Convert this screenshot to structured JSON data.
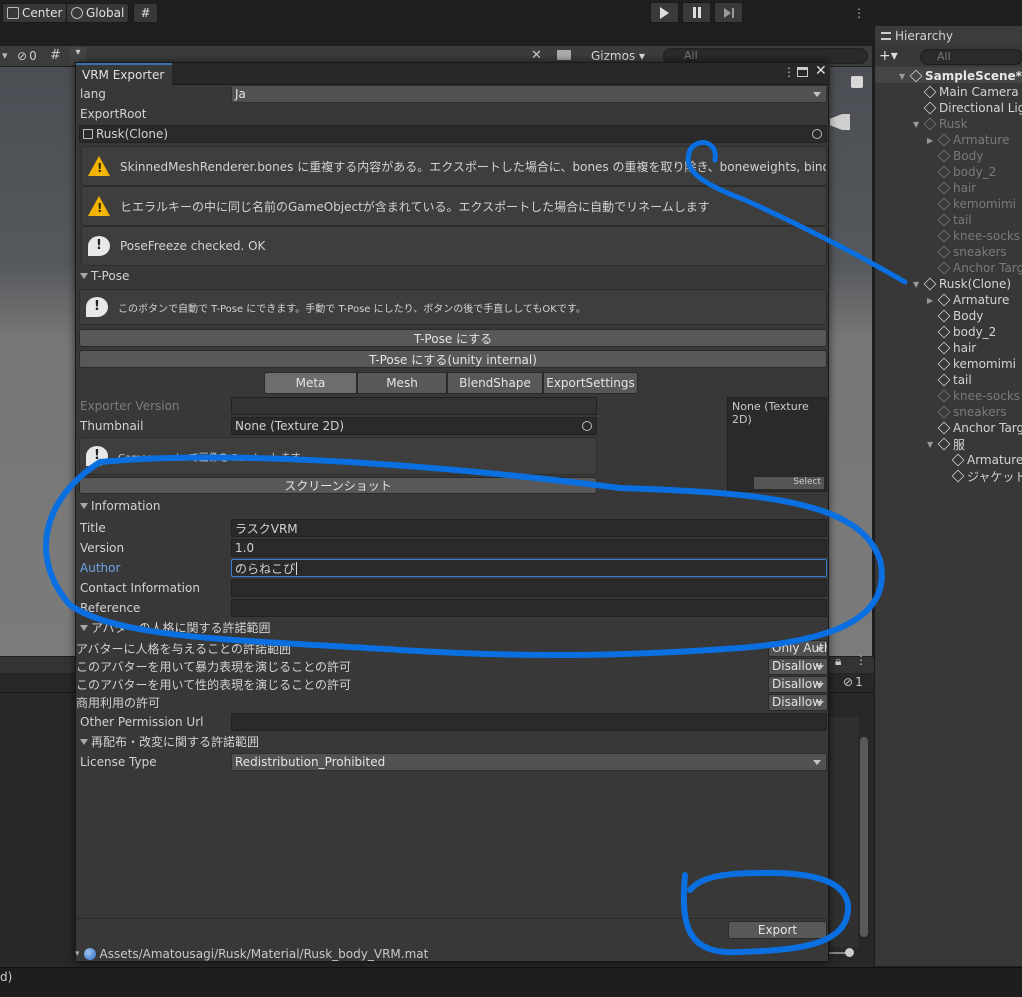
{
  "toolbar": {
    "center": "Center",
    "global": "Global"
  },
  "scene": {
    "gizmos": "Gizmos",
    "search_placeholder": "All",
    "vis_count": "0"
  },
  "hierarchy": {
    "title": "Hierarchy",
    "search_placeholder": "All",
    "items": [
      {
        "label": "SampleScene*",
        "dim": false
      },
      {
        "label": "Main Camera",
        "dim": false
      },
      {
        "label": "Directional Light",
        "dim": false
      },
      {
        "label": "Rusk",
        "dim": true
      },
      {
        "label": "Armature",
        "dim": true
      },
      {
        "label": "Body",
        "dim": true
      },
      {
        "label": "body_2",
        "dim": true
      },
      {
        "label": "hair",
        "dim": true
      },
      {
        "label": "kemomimi",
        "dim": true
      },
      {
        "label": "tail",
        "dim": true
      },
      {
        "label": "knee-socks",
        "dim": true
      },
      {
        "label": "sneakers",
        "dim": true
      },
      {
        "label": "Anchor Target",
        "dim": true
      },
      {
        "label": "Rusk(Clone)",
        "dim": false
      },
      {
        "label": "Armature",
        "dim": false
      },
      {
        "label": "Body",
        "dim": false
      },
      {
        "label": "body_2",
        "dim": false
      },
      {
        "label": "hair",
        "dim": false
      },
      {
        "label": "kemomimi",
        "dim": false
      },
      {
        "label": "tail",
        "dim": false
      },
      {
        "label": "knee-socks",
        "dim": true
      },
      {
        "label": "sneakers",
        "dim": true
      },
      {
        "label": "Anchor Target",
        "dim": false
      },
      {
        "label": "服",
        "dim": false
      },
      {
        "label": "Armature",
        "dim": false
      },
      {
        "label": "ジャケット",
        "dim": false
      }
    ]
  },
  "window": {
    "tab": "VRM Exporter"
  },
  "lang": {
    "label": "lang",
    "value": "Ja"
  },
  "export_root": {
    "label": "ExportRoot",
    "value": "Rusk(Clone)"
  },
  "messages": {
    "warn1": "SkinnedMeshRenderer.bones に重複する内容がある。エクスポートした場合に、bones の重複を取り除き、boneweights, bindposes を調整します",
    "warn2": "ヒエラルキーの中に同じ名前のGameObjectが含まれている。エクスポートした場合に自動でリネームします",
    "info1": "PoseFreeze checked. OK"
  },
  "tpose": {
    "header": "T-Pose",
    "help": "このボタンで自動で T-Pose にできます。手動で T-Pose にしたり、ボタンの後で手直ししてもOKです。",
    "button1": "T-Pose にする",
    "button2": "T-Pose にする(unity internal)"
  },
  "tabs": [
    "Meta",
    "Mesh",
    "BlendShape",
    "ExportSettings"
  ],
  "meta": {
    "exporter_version_label": "Exporter Version",
    "thumbnail_label": "Thumbnail",
    "thumbnail_value": "None (Texture 2D)",
    "thumb_help": "Camera.main で画像を Render します",
    "screenshot": "スクリーンショット",
    "preview_label": "None (Texture 2D)",
    "select": "Select"
  },
  "information": {
    "header": "Information",
    "title_label": "Title",
    "title_value": "ラスクVRM",
    "version_label": "Version",
    "version_value": "1.0",
    "author_label": "Author",
    "author_value": "のらねこぴ",
    "contact_label": "Contact Information",
    "contact_value": "",
    "reference_label": "Reference",
    "reference_value": ""
  },
  "permission": {
    "header": "アバターの人格に関する許諾範囲",
    "rows": [
      {
        "label": "アバターに人格を与えることの許諾範囲",
        "value": "Only Author"
      },
      {
        "label": "このアバターを用いて暴力表現を演じることの許可",
        "value": "Disallow"
      },
      {
        "label": "このアバターを用いて性的表現を演じることの許可",
        "value": "Disallow"
      },
      {
        "label": "商用利用の許可",
        "value": "Disallow"
      }
    ],
    "other_url_label": "Other Permission Url"
  },
  "redistribution": {
    "header": "再配布・改変に関する許諾範囲",
    "license_label": "License Type",
    "license_value": "Redistribution_Prohibited"
  },
  "export_button": "Export",
  "asset_path": "Assets/Amatousagi/Rusk/Material/Rusk_body_VRM.mat",
  "bottom": {
    "count": "1"
  },
  "status": {
    "text": "d)"
  },
  "annotation_color": "#0a6fe0"
}
